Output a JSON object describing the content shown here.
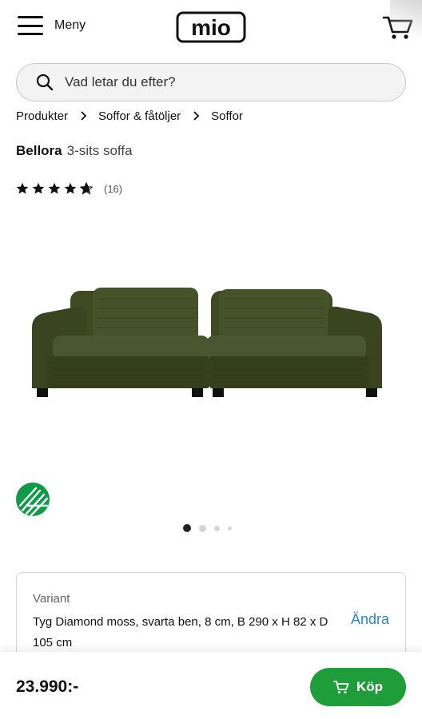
{
  "header": {
    "menu_label": "Meny",
    "logo_text": "mio",
    "menu_icon": "hamburger-icon",
    "cart_icon": "cart-icon"
  },
  "search": {
    "placeholder": "Vad letar du efter?",
    "icon": "search-icon"
  },
  "breadcrumb": {
    "items": [
      "Produkter",
      "Soffor & fåtöljer",
      "Soffor"
    ]
  },
  "product": {
    "brand": "Bellora",
    "subtitle": "3-sits soffa",
    "rating": 4.5,
    "rating_max": 5,
    "review_count": "(16)",
    "image_icon": "sofa-image",
    "eco_badge_icon": "nordic-swan-ecolabel-icon",
    "image_count": 4,
    "current_image": 1
  },
  "variant": {
    "label": "Variant",
    "value": "Tyg Diamond moss, svarta ben, 8 cm, B 290 x H 82 x D 105 cm",
    "change_label": "Ändra"
  },
  "bottom_bar": {
    "price": "23.990:-",
    "buy_label": "Köp",
    "buy_icon": "cart-icon"
  },
  "colors": {
    "accent_green": "#1f9d3a",
    "link_blue": "#2c86c4",
    "eco_green": "#0f9a48",
    "sofa_green": "#3b4520"
  }
}
